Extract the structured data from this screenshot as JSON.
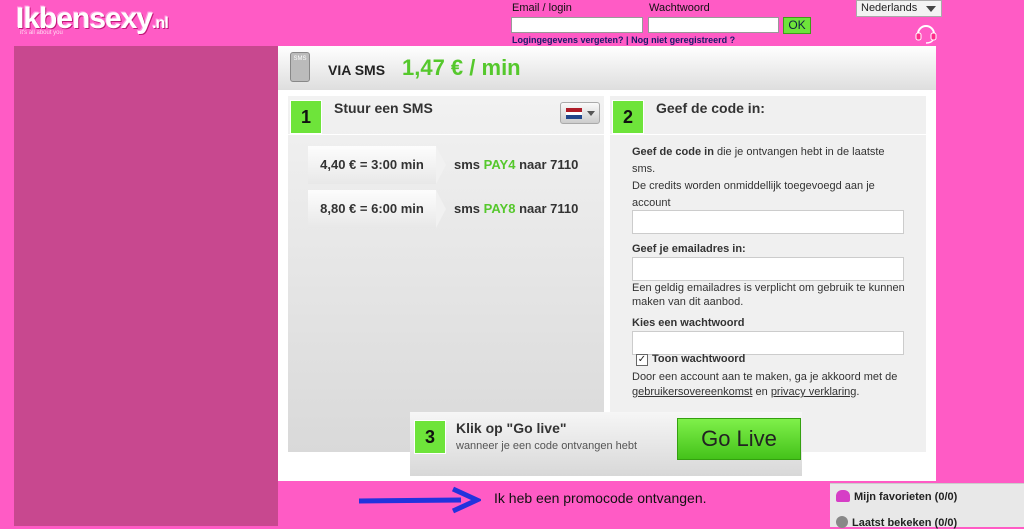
{
  "brand": {
    "logo_main": "Ikbensexy",
    "logo_tld": ".nl",
    "logo_tagline": "it's all about you"
  },
  "login": {
    "email_label": "Email / login",
    "password_label": "Wachtwoord",
    "ok_label": "OK",
    "forgot_link": "Logingegevens vergeten?",
    "separator": "|",
    "register_link": "Nog niet geregistreerd ?"
  },
  "language": {
    "selected": "Nederlands"
  },
  "icons": {
    "headset": "headset-icon",
    "sms": "sms-phone-icon",
    "flag": "netherlands-flag-icon",
    "heart": "heart-icon",
    "clock": "clock-icon",
    "arrow": "arrow-right-icon"
  },
  "offer": {
    "via_label": "VIA SMS",
    "price": "1,47 € / min",
    "sms_icon_text": "SMS"
  },
  "step1": {
    "number": "1",
    "title": "Stuur een SMS",
    "options": [
      {
        "price": "4,40 € = 3:00 min",
        "prefix": "sms",
        "keyword": "PAY4",
        "suffix": "naar 7110"
      },
      {
        "price": "8,80 € = 6:00 min",
        "prefix": "sms",
        "keyword": "PAY8",
        "suffix": "naar 7110"
      }
    ]
  },
  "step2": {
    "number": "2",
    "title": "Geef de code in:",
    "code_label_bold": "Geef de code in",
    "code_label_rest": " die je ontvangen hebt in de laatste sms.",
    "code_hint": "De credits worden onmiddellijk toegevoegd aan je account",
    "email_label": "Geef je emailadres in:",
    "email_hint": "Een geldig emailadres is verplicht om gebruik te kunnen maken van dit aanbod.",
    "password_label": "Kies een wachtwoord",
    "show_password_label": "Toon wachtwoord",
    "show_password_checked": true,
    "terms_prefix": "Door een account aan te maken, ga je akkoord met de ",
    "terms_link": "gebruikersovereenkomst",
    "terms_and": " en ",
    "privacy_link": "privacy verklaring",
    "terms_end": "."
  },
  "step3": {
    "number": "3",
    "title": "Klik op \"Go live\"",
    "subtitle": "wanneer je een code ontvangen hebt",
    "button_label": "Go Live"
  },
  "promo": {
    "text": "Ik heb een promocode ontvangen."
  },
  "sidebar": {
    "favorites": "Mijn favorieten (0/0)",
    "recent": "Laatst bekeken (0/0)"
  },
  "colors": {
    "background": "#ff5bc5",
    "accent_green": "#55c82c",
    "button_green": "#6ee43a"
  }
}
